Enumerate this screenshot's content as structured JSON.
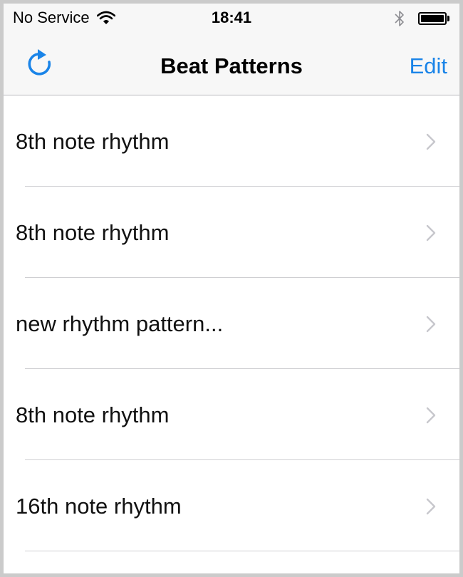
{
  "status_bar": {
    "carrier": "No Service",
    "time": "18:41",
    "battery_level": 1.0
  },
  "nav_bar": {
    "title": "Beat Patterns",
    "edit_label": "Edit",
    "accent_color": "#1a84e8"
  },
  "icons": {
    "wifi": "wifi-icon",
    "bluetooth": "bluetooth-icon",
    "battery": "battery-icon",
    "refresh": "refresh-icon",
    "chevron": "chevron-right-icon"
  },
  "patterns": [
    {
      "label": "8th note rhythm"
    },
    {
      "label": "8th note rhythm"
    },
    {
      "label": "new rhythm pattern..."
    },
    {
      "label": "8th note rhythm"
    },
    {
      "label": "16th note rhythm"
    }
  ]
}
